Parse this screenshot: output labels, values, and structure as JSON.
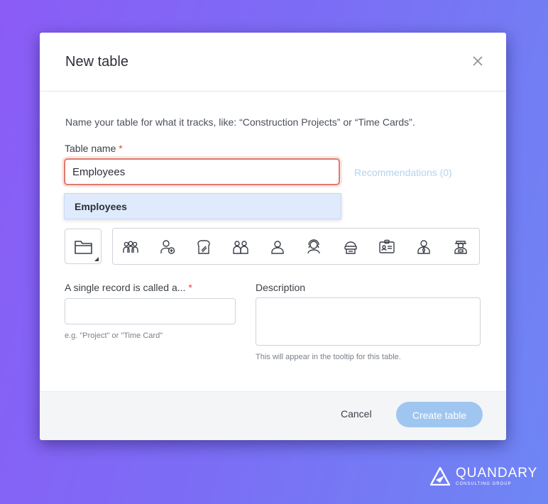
{
  "modal": {
    "title": "New table",
    "hint": "Name your table for what it tracks, like: “Construction Projects” or “Time Cards”.",
    "table_name_label": "Table name",
    "required_mark": "*",
    "table_name_value": "Employees",
    "recommendations": "Recommendations (0)",
    "dropdown_items": [
      "Employees"
    ],
    "icon_strip": [
      "people-group-icon",
      "person-add-icon",
      "toast-icon",
      "couple-icon",
      "person-icon",
      "person-headset-icon",
      "driver-icon",
      "id-card-icon",
      "person-tie-icon",
      "person-hat-icon"
    ],
    "record_label": "A single record is called a...",
    "record_value": "",
    "record_helper": "e.g. \"Project\" or \"Time Card\"",
    "description_label": "Description",
    "description_value": "",
    "description_helper": "This will appear in the tooltip for this table."
  },
  "footer": {
    "cancel_label": "Cancel",
    "create_label": "Create table"
  },
  "brand": {
    "name": "QUANDARY",
    "sub": "CONSULTING GROUP"
  },
  "colors": {
    "background_start": "#8b5cf6",
    "background_end": "#6e86f4",
    "input_focus": "#e07a6d",
    "dropdown_highlight": "#dfeafc",
    "primary_disabled": "#9fc6f0",
    "required": "#e0464b"
  }
}
